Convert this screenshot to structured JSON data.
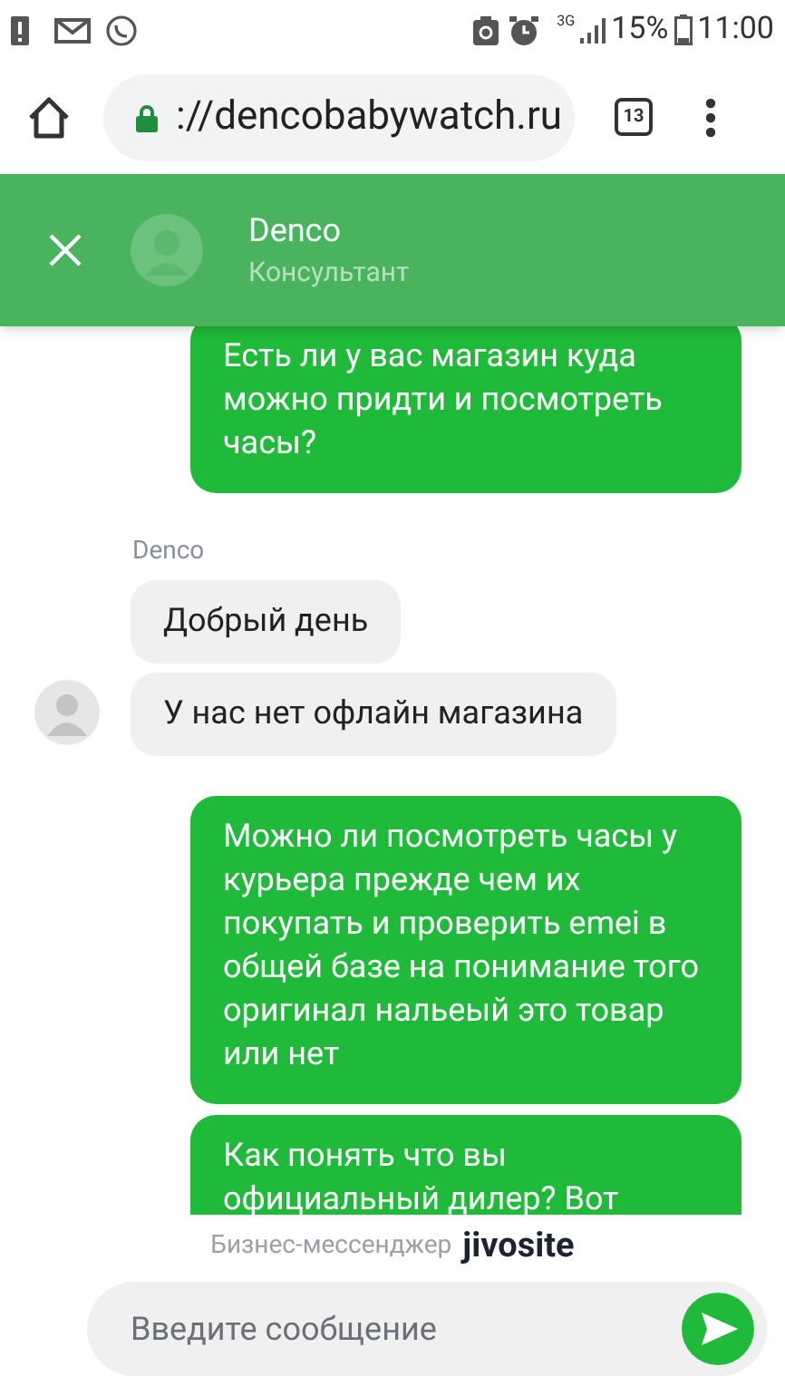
{
  "status_bar": {
    "network": "3G",
    "battery": "15%",
    "time": "11:00"
  },
  "browser": {
    "url": "://dencobabywatch.ru",
    "tab_count": "13"
  },
  "chat_header": {
    "name": "Denco",
    "role": "Консультант"
  },
  "messages": [
    {
      "kind": "out",
      "text": "Есть ли у вас магазин куда можно придти и посмотреть часы?"
    },
    {
      "kind": "author",
      "text": "Denco"
    },
    {
      "kind": "in",
      "text": "Добрый день",
      "avatar": false
    },
    {
      "kind": "in",
      "text": "У нас нет офлайн магазина",
      "avatar": true
    },
    {
      "kind": "out",
      "text": "Можно ли посмотреть часы у курьера прежде чем их покупать и проверить emei в общей базе на понимание того оригинал нальеый это товар или нет"
    },
    {
      "kind": "out",
      "text": "Как понять что вы официальный дилер? Вот"
    }
  ],
  "branding": {
    "label": "Бизнес-мессенджер",
    "logo": "jivosite"
  },
  "composer": {
    "placeholder": "Введите сообщение"
  }
}
